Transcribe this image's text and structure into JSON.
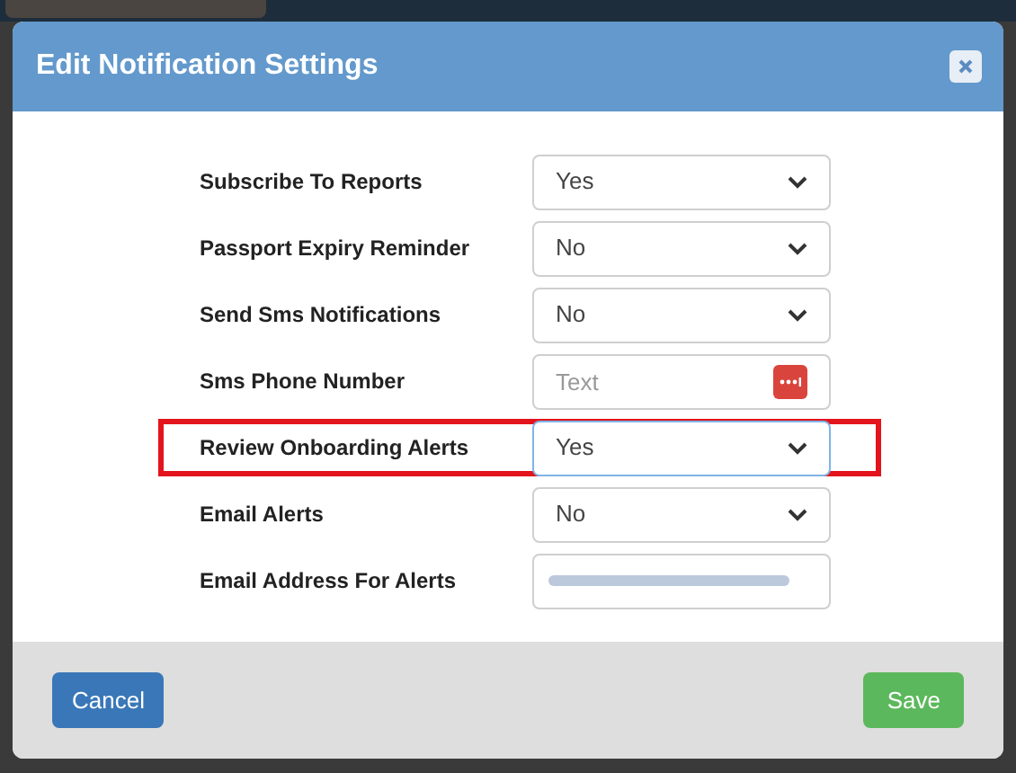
{
  "dialog": {
    "title": "Edit Notification Settings"
  },
  "fields": [
    {
      "label": "Subscribe To Reports",
      "kind": "select",
      "value": "Yes",
      "highlighted": false
    },
    {
      "label": "Passport Expiry Reminder",
      "kind": "select",
      "value": "No",
      "highlighted": false
    },
    {
      "label": "Send Sms Notifications",
      "kind": "select",
      "value": "No",
      "highlighted": false
    },
    {
      "label": "Sms Phone Number",
      "kind": "text",
      "placeholder": "Text",
      "highlighted": false
    },
    {
      "label": "Review Onboarding Alerts",
      "kind": "select",
      "value": "Yes",
      "highlighted": true
    },
    {
      "label": "Email Alerts",
      "kind": "select",
      "value": "No",
      "highlighted": false
    },
    {
      "label": "Email Address For Alerts",
      "kind": "blurred",
      "highlighted": false
    }
  ],
  "buttons": {
    "cancel": "Cancel",
    "save": "Save"
  }
}
